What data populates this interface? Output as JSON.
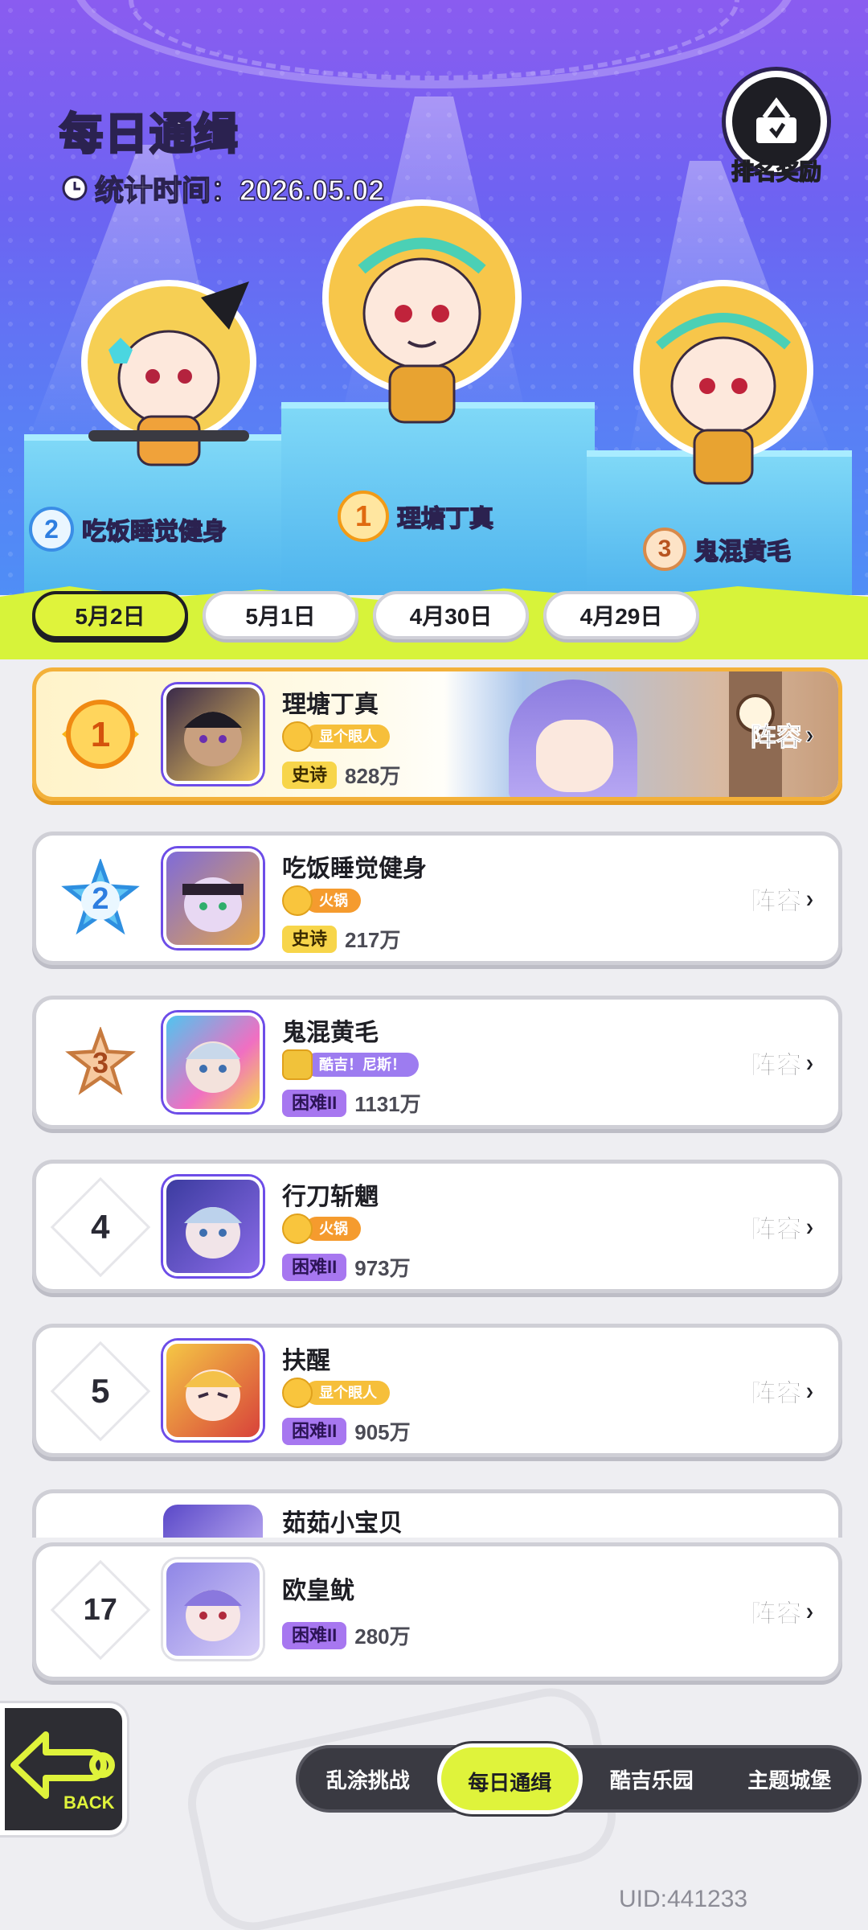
{
  "header": {
    "title": "每日通缉",
    "stat_label": "统计时间：2026.05.02",
    "reward_label": "排名奖励"
  },
  "podium": [
    {
      "rank": "2",
      "name": "吃饭睡觉健身"
    },
    {
      "rank": "1",
      "name": "理塘丁真"
    },
    {
      "rank": "3",
      "name": "鬼混黄毛"
    }
  ],
  "date_tabs": [
    {
      "label": "5月2日",
      "active": true
    },
    {
      "label": "5月1日",
      "active": false
    },
    {
      "label": "4月30日",
      "active": false
    },
    {
      "label": "4月29日",
      "active": false
    }
  ],
  "rows": [
    {
      "rank": "1",
      "name": "理塘丁真",
      "title": "显个眼人",
      "tier": "史诗",
      "score": "828万",
      "action": "阵容"
    },
    {
      "rank": "2",
      "name": "吃饭睡觉健身",
      "title": "火锅",
      "tier": "史诗",
      "score": "217万",
      "action": "阵容"
    },
    {
      "rank": "3",
      "name": "鬼混黄毛",
      "title": "酷吉！尼斯！",
      "tier": "困难II",
      "score": "1131万",
      "action": "阵容"
    },
    {
      "rank": "4",
      "name": "行刀斩魍",
      "title": "火锅",
      "tier": "困难II",
      "score": "973万",
      "action": "阵容"
    },
    {
      "rank": "5",
      "name": "扶醒",
      "title": "显个眼人",
      "tier": "困难II",
      "score": "905万",
      "action": "阵容"
    }
  ],
  "partial_row": {
    "name": "茹茹小宝贝"
  },
  "my_row": {
    "rank": "17",
    "name": "欧皇鱿",
    "tier": "困难II",
    "score": "280万",
    "action": "阵容"
  },
  "back_label": "BACK",
  "bottom_nav": [
    {
      "label": "乱涂挑战",
      "active": false
    },
    {
      "label": "每日通缉",
      "active": true
    },
    {
      "label": "酷吉乐园",
      "active": false
    },
    {
      "label": "主题城堡",
      "active": false
    }
  ],
  "uid": "UID:441233",
  "colors": {
    "accent": "#dff33b",
    "gold": "#f3b13a",
    "purple": "#6d4de8",
    "stage": "#6d63f2"
  }
}
